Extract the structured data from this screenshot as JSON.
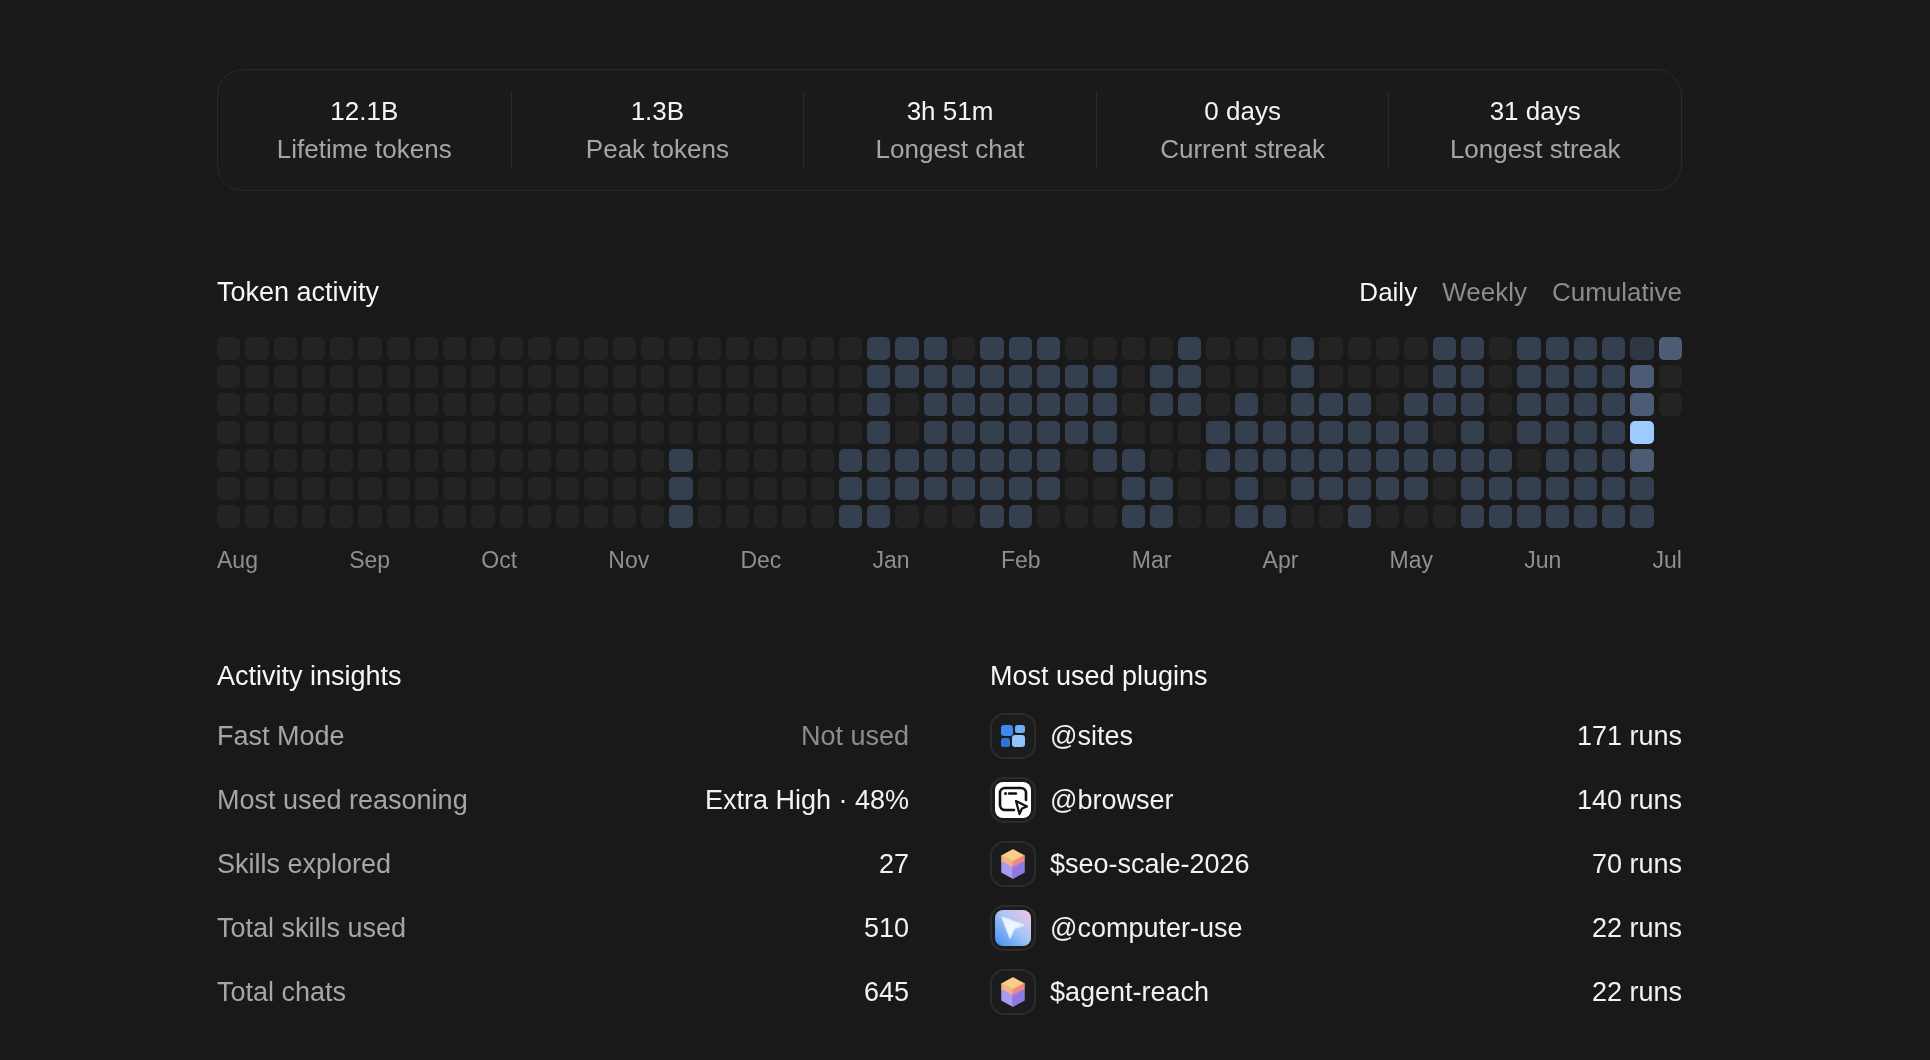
{
  "stats": [
    {
      "value": "12.1B",
      "label": "Lifetime tokens"
    },
    {
      "value": "1.3B",
      "label": "Peak tokens"
    },
    {
      "value": "3h 51m",
      "label": "Longest chat"
    },
    {
      "value": "0 days",
      "label": "Current streak"
    },
    {
      "value": "31 days",
      "label": "Longest streak"
    }
  ],
  "token_activity": {
    "title": "Token activity",
    "tabs": [
      {
        "label": "Daily",
        "selected": true
      },
      {
        "label": "Weekly",
        "selected": false
      },
      {
        "label": "Cumulative",
        "selected": false
      }
    ],
    "heatmap": {
      "weeks": [
        [
          {
            "color": "#232323"
          },
          {
            "color": "#232323"
          },
          {
            "color": "#232323"
          },
          {
            "color": "#232323"
          },
          {
            "color": "#232323"
          },
          {
            "color": "#232323"
          },
          {
            "color": "#232323"
          }
        ],
        [
          {
            "color": "#232323"
          },
          {
            "color": "#232323"
          },
          {
            "color": "#232323"
          },
          {
            "color": "#232323"
          },
          {
            "color": "#232323"
          },
          {
            "color": "#232323"
          },
          {
            "color": "#232323"
          }
        ],
        [
          {
            "color": "#232323"
          },
          {
            "color": "#232323"
          },
          {
            "color": "#232323"
          },
          {
            "color": "#232323"
          },
          {
            "color": "#232323"
          },
          {
            "color": "#232323"
          },
          {
            "color": "#232323"
          }
        ],
        [
          {
            "color": "#232323"
          },
          {
            "color": "#232323"
          },
          {
            "color": "#232323"
          },
          {
            "color": "#232323"
          },
          {
            "color": "#232323"
          },
          {
            "color": "#232323"
          },
          {
            "color": "#232323"
          }
        ],
        [
          {
            "color": "#232323"
          },
          {
            "color": "#232323"
          },
          {
            "color": "#232323"
          },
          {
            "color": "#232323"
          },
          {
            "color": "#232323"
          },
          {
            "color": "#232323"
          },
          {
            "color": "#232323"
          }
        ],
        [
          {
            "color": "#232323"
          },
          {
            "color": "#232323"
          },
          {
            "color": "#232323"
          },
          {
            "color": "#232323"
          },
          {
            "color": "#232323"
          },
          {
            "color": "#232323"
          },
          {
            "color": "#232323"
          }
        ],
        [
          {
            "color": "#232323"
          },
          {
            "color": "#232323"
          },
          {
            "color": "#232323"
          },
          {
            "color": "#232323"
          },
          {
            "color": "#232323"
          },
          {
            "color": "#232323"
          },
          {
            "color": "#232323"
          }
        ],
        [
          {
            "color": "#232323"
          },
          {
            "color": "#232323"
          },
          {
            "color": "#232323"
          },
          {
            "color": "#232323"
          },
          {
            "color": "#232323"
          },
          {
            "color": "#232323"
          },
          {
            "color": "#232323"
          }
        ],
        [
          {
            "color": "#232323"
          },
          {
            "color": "#232323"
          },
          {
            "color": "#232323"
          },
          {
            "color": "#232323"
          },
          {
            "color": "#232323"
          },
          {
            "color": "#232323"
          },
          {
            "color": "#232323"
          }
        ],
        [
          {
            "color": "#232323"
          },
          {
            "color": "#232323"
          },
          {
            "color": "#232323"
          },
          {
            "color": "#232323"
          },
          {
            "color": "#232323"
          },
          {
            "color": "#232323"
          },
          {
            "color": "#232323"
          }
        ],
        [
          {
            "color": "#232323"
          },
          {
            "color": "#232323"
          },
          {
            "color": "#232323"
          },
          {
            "color": "#232323"
          },
          {
            "color": "#232323"
          },
          {
            "color": "#232323"
          },
          {
            "color": "#232323"
          }
        ],
        [
          {
            "color": "#232323"
          },
          {
            "color": "#232323"
          },
          {
            "color": "#232323"
          },
          {
            "color": "#232323"
          },
          {
            "color": "#232323"
          },
          {
            "color": "#232323"
          },
          {
            "color": "#232323"
          }
        ],
        [
          {
            "color": "#232323"
          },
          {
            "color": "#232323"
          },
          {
            "color": "#232323"
          },
          {
            "color": "#232323"
          },
          {
            "color": "#232323"
          },
          {
            "color": "#232323"
          },
          {
            "color": "#232323"
          }
        ],
        [
          {
            "color": "#232323"
          },
          {
            "color": "#232323"
          },
          {
            "color": "#232323"
          },
          {
            "color": "#232323"
          },
          {
            "color": "#232323"
          },
          {
            "color": "#232323"
          },
          {
            "color": "#232323"
          }
        ],
        [
          {
            "color": "#232323"
          },
          {
            "color": "#232323"
          },
          {
            "color": "#232323"
          },
          {
            "color": "#232323"
          },
          {
            "color": "#232323"
          },
          {
            "color": "#232323"
          },
          {
            "color": "#232323"
          }
        ],
        [
          {
            "color": "#232323"
          },
          {
            "color": "#232323"
          },
          {
            "color": "#232323"
          },
          {
            "color": "#232323"
          },
          {
            "color": "#232323"
          },
          {
            "color": "#232323"
          },
          {
            "color": "#232323"
          }
        ],
        [
          {
            "color": "#232323"
          },
          {
            "color": "#232323"
          },
          {
            "color": "#232323"
          },
          {
            "color": "#232323"
          },
          {
            "color": "#343f4f"
          },
          {
            "color": "#343f4f"
          },
          {
            "color": "#343f4f"
          }
        ],
        [
          {
            "color": "#232323"
          },
          {
            "color": "#232323"
          },
          {
            "color": "#232323"
          },
          {
            "color": "#232323"
          },
          {
            "color": "#232323"
          },
          {
            "color": "#232323"
          },
          {
            "color": "#232323"
          }
        ],
        [
          {
            "color": "#232323"
          },
          {
            "color": "#232323"
          },
          {
            "color": "#232323"
          },
          {
            "color": "#232323"
          },
          {
            "color": "#232323"
          },
          {
            "color": "#232323"
          },
          {
            "color": "#232323"
          }
        ],
        [
          {
            "color": "#232323"
          },
          {
            "color": "#232323"
          },
          {
            "color": "#232323"
          },
          {
            "color": "#232323"
          },
          {
            "color": "#232323"
          },
          {
            "color": "#232323"
          },
          {
            "color": "#232323"
          }
        ],
        [
          {
            "color": "#232323"
          },
          {
            "color": "#232323"
          },
          {
            "color": "#232323"
          },
          {
            "color": "#232323"
          },
          {
            "color": "#232323"
          },
          {
            "color": "#232323"
          },
          {
            "color": "#232323"
          }
        ],
        [
          {
            "color": "#232323"
          },
          {
            "color": "#232323"
          },
          {
            "color": "#232323"
          },
          {
            "color": "#232323"
          },
          {
            "color": "#232323"
          },
          {
            "color": "#232323"
          },
          {
            "color": "#232323"
          }
        ],
        [
          {
            "color": "#232323"
          },
          {
            "color": "#232323"
          },
          {
            "color": "#232323"
          },
          {
            "color": "#232323"
          },
          {
            "color": "#343f4f"
          },
          {
            "color": "#343f4f"
          },
          {
            "color": "#343f4f"
          }
        ],
        [
          {
            "color": "#343f4f"
          },
          {
            "color": "#343f4f"
          },
          {
            "color": "#343f4f"
          },
          {
            "color": "#343f4f"
          },
          {
            "color": "#343f4f"
          },
          {
            "color": "#343f4f"
          },
          {
            "color": "#343f4f"
          }
        ],
        [
          {
            "color": "#343f4f"
          },
          {
            "color": "#343f4f"
          },
          {
            "color": "#232323"
          },
          {
            "color": "#232323"
          },
          {
            "color": "#343f4f"
          },
          {
            "color": "#343f4f"
          },
          {
            "color": "#232323"
          }
        ],
        [
          {
            "color": "#343f4f"
          },
          {
            "color": "#343f4f"
          },
          {
            "color": "#343f4f"
          },
          {
            "color": "#343f4f"
          },
          {
            "color": "#343f4f"
          },
          {
            "color": "#343f4f"
          },
          {
            "color": "#232323"
          }
        ],
        [
          {
            "color": "#232323"
          },
          {
            "color": "#343f4f"
          },
          {
            "color": "#343f4f"
          },
          {
            "color": "#343f4f"
          },
          {
            "color": "#343f4f"
          },
          {
            "color": "#343f4f"
          },
          {
            "color": "#232323"
          }
        ],
        [
          {
            "color": "#343f4f"
          },
          {
            "color": "#343f4f"
          },
          {
            "color": "#343f4f"
          },
          {
            "color": "#343f4f"
          },
          {
            "color": "#343f4f"
          },
          {
            "color": "#343f4f"
          },
          {
            "color": "#343f4f"
          }
        ],
        [
          {
            "color": "#343f4f"
          },
          {
            "color": "#343f4f"
          },
          {
            "color": "#343f4f"
          },
          {
            "color": "#343f4f"
          },
          {
            "color": "#343f4f"
          },
          {
            "color": "#343f4f"
          },
          {
            "color": "#343f4f"
          }
        ],
        [
          {
            "color": "#343f4f"
          },
          {
            "color": "#343f4f"
          },
          {
            "color": "#343f4f"
          },
          {
            "color": "#343f4f"
          },
          {
            "color": "#343f4f"
          },
          {
            "color": "#343f4f"
          },
          {
            "color": "#232323"
          }
        ],
        [
          {
            "color": "#232323"
          },
          {
            "color": "#343f4f"
          },
          {
            "color": "#343f4f"
          },
          {
            "color": "#343f4f"
          },
          {
            "color": "#232323"
          },
          {
            "color": "#232323"
          },
          {
            "color": "#232323"
          }
        ],
        [
          {
            "color": "#232323"
          },
          {
            "color": "#343f4f"
          },
          {
            "color": "#343f4f"
          },
          {
            "color": "#343f4f"
          },
          {
            "color": "#343f4f"
          },
          {
            "color": "#232323"
          },
          {
            "color": "#232323"
          }
        ],
        [
          {
            "color": "#232323"
          },
          {
            "color": "#232323"
          },
          {
            "color": "#232323"
          },
          {
            "color": "#232323"
          },
          {
            "color": "#343f4f"
          },
          {
            "color": "#343f4f"
          },
          {
            "color": "#343f4f"
          }
        ],
        [
          {
            "color": "#232323"
          },
          {
            "color": "#343f4f"
          },
          {
            "color": "#343f4f"
          },
          {
            "color": "#232323"
          },
          {
            "color": "#232323"
          },
          {
            "color": "#343f4f"
          },
          {
            "color": "#343f4f"
          }
        ],
        [
          {
            "color": "#343f4f"
          },
          {
            "color": "#343f4f"
          },
          {
            "color": "#343f4f"
          },
          {
            "color": "#232323"
          },
          {
            "color": "#232323"
          },
          {
            "color": "#232323"
          },
          {
            "color": "#232323"
          }
        ],
        [
          {
            "color": "#232323"
          },
          {
            "color": "#232323"
          },
          {
            "color": "#232323"
          },
          {
            "color": "#343f4f"
          },
          {
            "color": "#343f4f"
          },
          {
            "color": "#232323"
          },
          {
            "color": "#232323"
          }
        ],
        [
          {
            "color": "#232323"
          },
          {
            "color": "#232323"
          },
          {
            "color": "#343f4f"
          },
          {
            "color": "#343f4f"
          },
          {
            "color": "#343f4f"
          },
          {
            "color": "#343f4f"
          },
          {
            "color": "#343f4f"
          }
        ],
        [
          {
            "color": "#232323"
          },
          {
            "color": "#232323"
          },
          {
            "color": "#232323"
          },
          {
            "color": "#343f4f"
          },
          {
            "color": "#343f4f"
          },
          {
            "color": "#232323"
          },
          {
            "color": "#343f4f"
          }
        ],
        [
          {
            "color": "#343f4f"
          },
          {
            "color": "#343f4f"
          },
          {
            "color": "#343f4f"
          },
          {
            "color": "#343f4f"
          },
          {
            "color": "#343f4f"
          },
          {
            "color": "#343f4f"
          },
          {
            "color": "#232323"
          }
        ],
        [
          {
            "color": "#232323"
          },
          {
            "color": "#232323"
          },
          {
            "color": "#343f4f"
          },
          {
            "color": "#343f4f"
          },
          {
            "color": "#343f4f"
          },
          {
            "color": "#343f4f"
          },
          {
            "color": "#232323"
          }
        ],
        [
          {
            "color": "#232323"
          },
          {
            "color": "#232323"
          },
          {
            "color": "#343f4f"
          },
          {
            "color": "#343f4f"
          },
          {
            "color": "#343f4f"
          },
          {
            "color": "#343f4f"
          },
          {
            "color": "#343f4f"
          }
        ],
        [
          {
            "color": "#232323"
          },
          {
            "color": "#232323"
          },
          {
            "color": "#232323"
          },
          {
            "color": "#343f4f"
          },
          {
            "color": "#343f4f"
          },
          {
            "color": "#343f4f"
          },
          {
            "color": "#232323"
          }
        ],
        [
          {
            "color": "#232323"
          },
          {
            "color": "#232323"
          },
          {
            "color": "#343f4f"
          },
          {
            "color": "#343f4f"
          },
          {
            "color": "#343f4f"
          },
          {
            "color": "#343f4f"
          },
          {
            "color": "#232323"
          }
        ],
        [
          {
            "color": "#343f4f"
          },
          {
            "color": "#343f4f"
          },
          {
            "color": "#343f4f"
          },
          {
            "color": "#232323"
          },
          {
            "color": "#343f4f"
          },
          {
            "color": "#232323"
          },
          {
            "color": "#232323"
          }
        ],
        [
          {
            "color": "#343f4f"
          },
          {
            "color": "#343f4f"
          },
          {
            "color": "#343f4f"
          },
          {
            "color": "#343f4f"
          },
          {
            "color": "#343f4f"
          },
          {
            "color": "#343f4f"
          },
          {
            "color": "#343f4f"
          }
        ],
        [
          {
            "color": "#232323"
          },
          {
            "color": "#232323"
          },
          {
            "color": "#232323"
          },
          {
            "color": "#232323"
          },
          {
            "color": "#343f4f"
          },
          {
            "color": "#343f4f"
          },
          {
            "color": "#343f4f"
          }
        ],
        [
          {
            "color": "#343f4f"
          },
          {
            "color": "#343f4f"
          },
          {
            "color": "#343f4f"
          },
          {
            "color": "#343f4f"
          },
          {
            "color": "#232323"
          },
          {
            "color": "#343f4f"
          },
          {
            "color": "#343f4f"
          }
        ],
        [
          {
            "color": "#343f4f"
          },
          {
            "color": "#343f4f"
          },
          {
            "color": "#343f4f"
          },
          {
            "color": "#343f4f"
          },
          {
            "color": "#343f4f"
          },
          {
            "color": "#343f4f"
          },
          {
            "color": "#343f4f"
          }
        ],
        [
          {
            "color": "#343f4f"
          },
          {
            "color": "#343f4f"
          },
          {
            "color": "#343f4f"
          },
          {
            "color": "#343f4f"
          },
          {
            "color": "#343f4f"
          },
          {
            "color": "#343f4f"
          },
          {
            "color": "#343f4f"
          }
        ],
        [
          {
            "color": "#343f4f"
          },
          {
            "color": "#343f4f"
          },
          {
            "color": "#343f4f"
          },
          {
            "color": "#343f4f"
          },
          {
            "color": "#343f4f"
          },
          {
            "color": "#343f4f"
          },
          {
            "color": "#343f4f"
          }
        ],
        [
          {
            "color": "#2e3845"
          },
          {
            "color": "#4b5c74"
          },
          {
            "color": "#4b5c74"
          },
          {
            "color": "#9dcbff"
          },
          {
            "color": "#4b5c74"
          },
          {
            "color": "#343f4f"
          },
          {
            "color": "#343f4f"
          }
        ],
        [
          {
            "color": "#4b5c74"
          },
          {
            "color": "#232323"
          },
          {
            "color": "#232323"
          }
        ]
      ]
    },
    "months": [
      "Aug",
      "Sep",
      "Oct",
      "Nov",
      "Dec",
      "Jan",
      "Feb",
      "Mar",
      "Apr",
      "May",
      "Jun",
      "Jul"
    ]
  },
  "activity_insights": {
    "title": "Activity insights",
    "rows": [
      {
        "label": "Fast Mode",
        "value": "Not used",
        "muted": true
      },
      {
        "label": "Most used reasoning",
        "value": "Extra High · 48%",
        "muted": false
      },
      {
        "label": "Skills explored",
        "value": "27",
        "muted": false
      },
      {
        "label": "Total skills used",
        "value": "510",
        "muted": false
      },
      {
        "label": "Total chats",
        "value": "645",
        "muted": false
      }
    ]
  },
  "most_used_plugins": {
    "title": "Most used plugins",
    "items": [
      {
        "kind": "grid",
        "name": "@sites",
        "runs": "171 runs"
      },
      {
        "kind": "browser",
        "name": "@browser",
        "runs": "140 runs"
      },
      {
        "kind": "cube",
        "name": "$seo-scale-2026",
        "runs": "70 runs"
      },
      {
        "kind": "pointer",
        "name": "@computer-use",
        "runs": "22 runs"
      },
      {
        "kind": "cube",
        "name": "$agent-reach",
        "runs": "22 runs"
      }
    ]
  }
}
